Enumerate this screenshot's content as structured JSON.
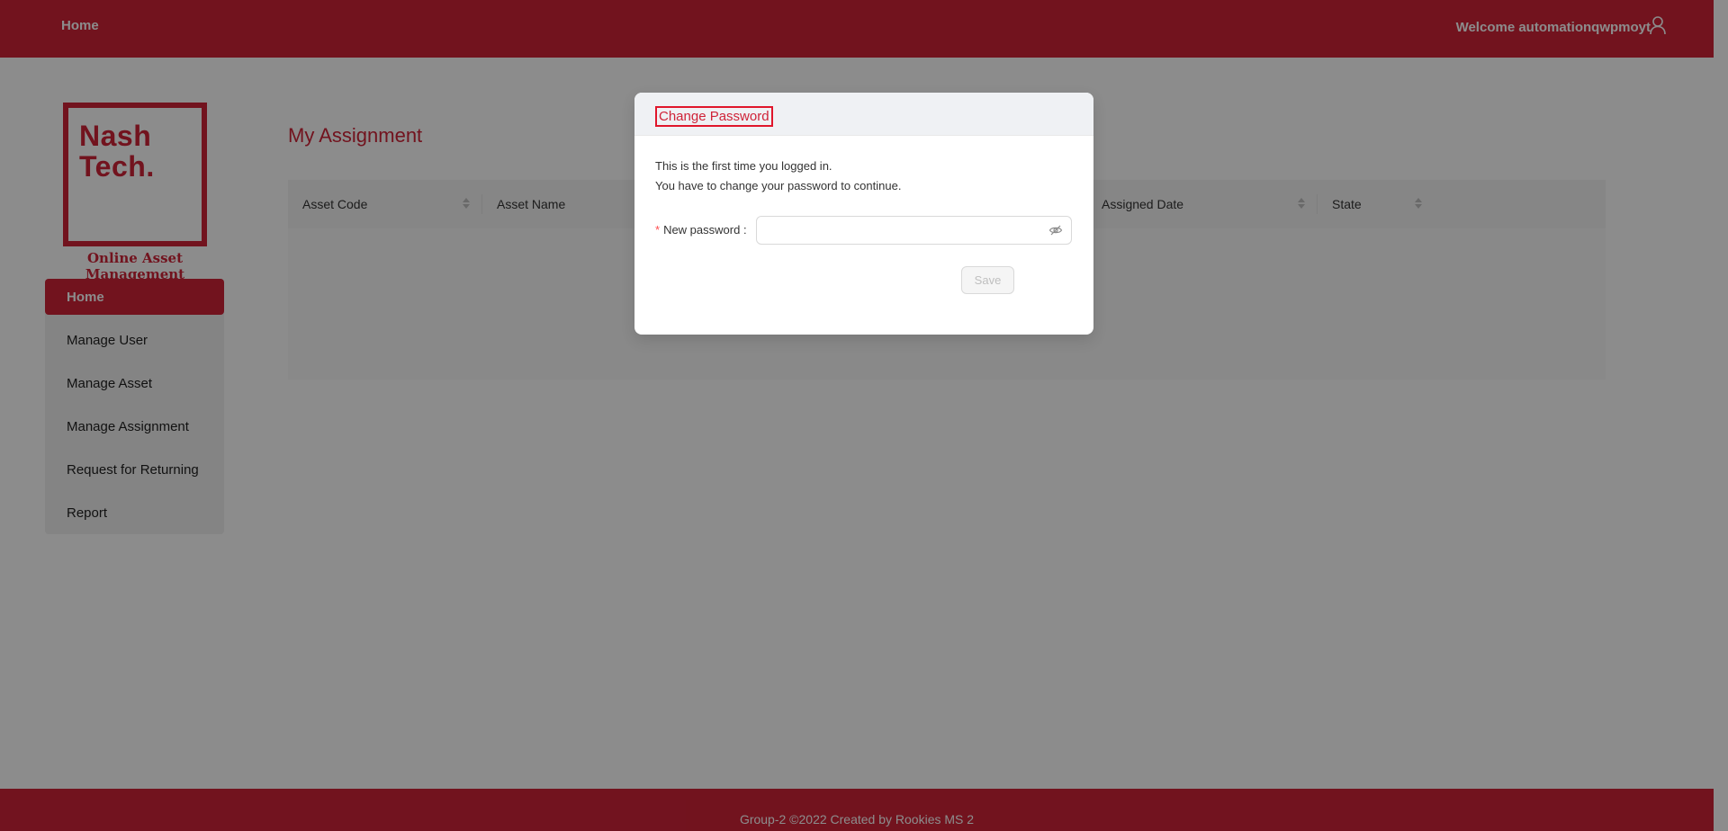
{
  "header": {
    "home_label": "Home",
    "welcome_text": "Welcome automationqwpmoyt",
    "user_icon": "user-icon"
  },
  "sidebar": {
    "logo_text_line1": "Nash",
    "logo_text_line2": "Tech.",
    "app_title": "Online Asset Management",
    "items": [
      {
        "label": "Home",
        "active": true
      },
      {
        "label": "Manage User",
        "active": false
      },
      {
        "label": "Manage Asset",
        "active": false
      },
      {
        "label": "Manage Assignment",
        "active": false
      },
      {
        "label": "Request for Returning",
        "active": false
      },
      {
        "label": "Report",
        "active": false
      }
    ]
  },
  "main": {
    "title": "My Assignment",
    "columns": [
      "Asset Code",
      "Asset Name",
      "Assigned Date",
      "State"
    ]
  },
  "modal": {
    "title": "Change Password",
    "message_line1": "This is the first time you logged in.",
    "message_line2": "You have to change your password to continue.",
    "password_label": "New password",
    "password_value": "",
    "save_label": "Save"
  },
  "footer": {
    "text": "Group-2 ©2022 Created by Rookies MS 2"
  },
  "colors": {
    "brand": "#cf2338"
  }
}
